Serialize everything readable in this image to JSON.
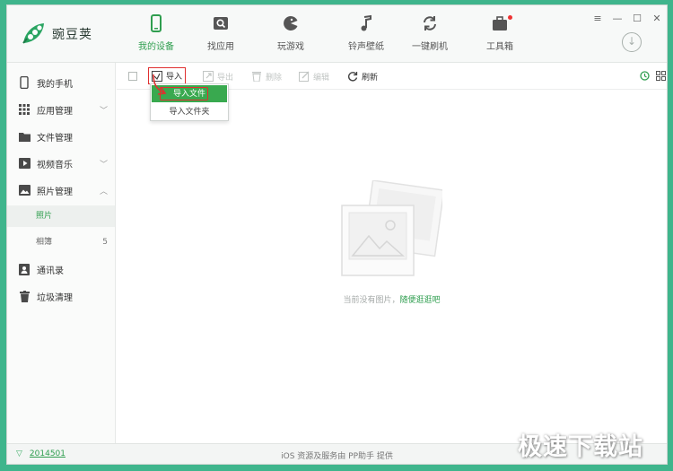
{
  "app": {
    "name": "豌豆荚"
  },
  "nav": {
    "items": [
      {
        "label": "我的设备",
        "icon": "phone-icon",
        "active": true
      },
      {
        "label": "找应用",
        "icon": "search-app-icon"
      },
      {
        "label": "玩游戏",
        "icon": "game-icon"
      },
      {
        "label": "铃声壁纸",
        "icon": "music-note-icon"
      },
      {
        "label": "一键刷机",
        "icon": "refresh-icon"
      },
      {
        "label": "工具箱",
        "icon": "toolbox-icon",
        "badge": true
      }
    ]
  },
  "window_controls": {
    "menu": "≡",
    "minimize": "—",
    "maximize": "☐",
    "close": "✕"
  },
  "sidebar": {
    "items": [
      {
        "label": "我的手机",
        "icon": "phone-icon"
      },
      {
        "label": "应用管理",
        "icon": "grid-icon",
        "chevron": "﹀"
      },
      {
        "label": "文件管理",
        "icon": "folder-icon"
      },
      {
        "label": "视频音乐",
        "icon": "video-icon",
        "chevron": "﹀"
      },
      {
        "label": "照片管理",
        "icon": "image-icon",
        "chevron": "︿"
      },
      {
        "label": "通讯录",
        "icon": "contacts-icon"
      },
      {
        "label": "垃圾清理",
        "icon": "trash-icon"
      }
    ],
    "subitems": [
      {
        "label": "照片",
        "active": true,
        "count": ""
      },
      {
        "label": "相簿",
        "count": "5"
      }
    ]
  },
  "toolbar": {
    "import": "导入",
    "export": "导出",
    "delete": "删除",
    "edit": "编辑",
    "refresh": "刷新"
  },
  "dropdown": {
    "items": [
      "导入文件",
      "导入文件夹"
    ]
  },
  "empty": {
    "text": "当前没有图片，",
    "link": "随便逛逛吧"
  },
  "status": {
    "version": "2014501",
    "center": "iOS 资源及服务由 PP助手 提供"
  },
  "watermark": "极速下载站",
  "colors": {
    "accent": "#2f9e4f",
    "highlight": "#e03030",
    "frame": "#3fb58c"
  }
}
